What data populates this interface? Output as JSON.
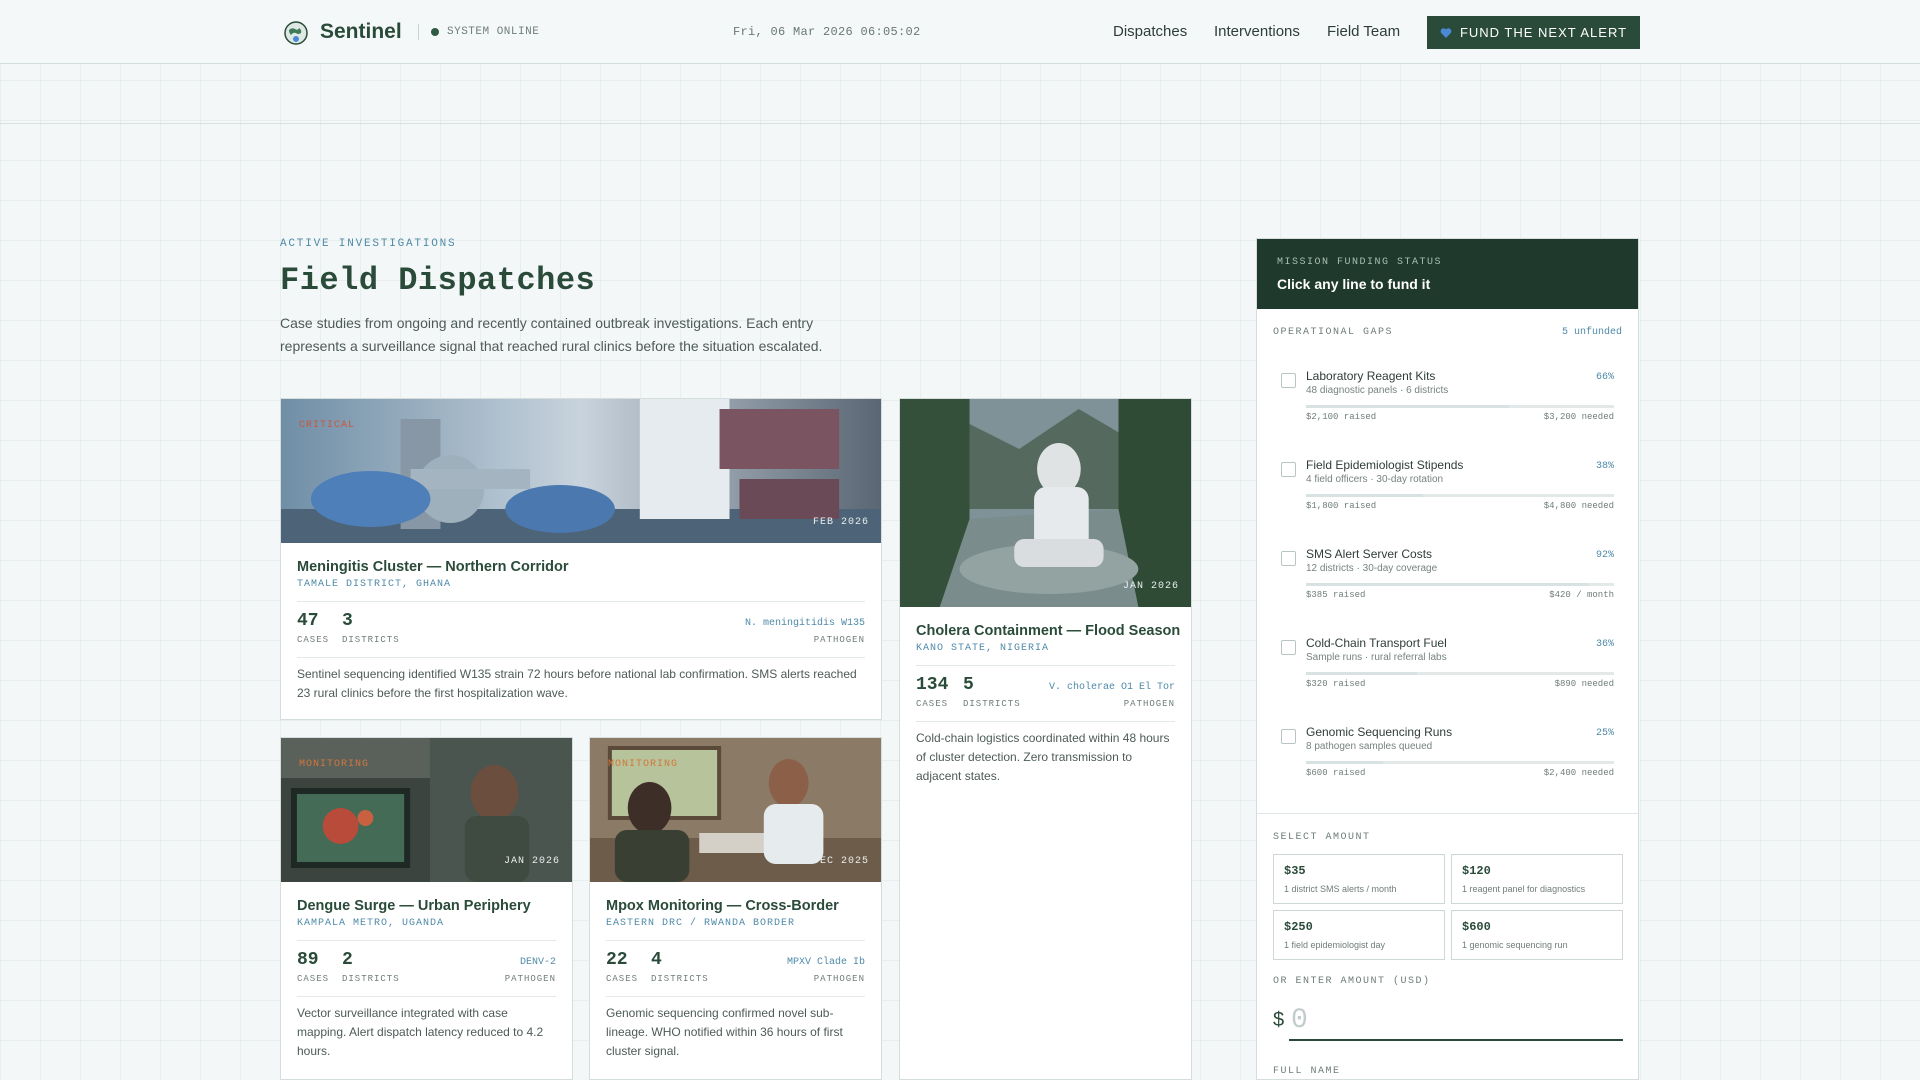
{
  "header": {
    "brand": "Sentinel",
    "status": "SYSTEM ONLINE",
    "clock": "Fri, 06 Mar 2026 06:05:02",
    "nav": [
      "Dispatches",
      "Interventions",
      "Field Team"
    ],
    "cta": "FUND THE NEXT ALERT"
  },
  "intro": {
    "eyebrow": "ACTIVE INVESTIGATIONS",
    "title": "Field Dispatches",
    "description": "Case studies from ongoing and recently contained outbreak investigations. Each entry represents a surveillance signal that reached rural clinics before the situation escalated."
  },
  "dispatches": [
    {
      "tag": "CRITICAL",
      "date": "FEB 2026",
      "title": "Meningitis Cluster — Northern Corridor",
      "location": "TAMALE DISTRICT, GHANA",
      "cases": "47",
      "cases_label": "CASES",
      "districts": "3",
      "districts_label": "DISTRICTS",
      "pathogen": "N. meningitidis W135",
      "pathogen_label": "PATHOGEN",
      "description": "Sentinel sequencing identified W135 strain 72 hours before national lab confirmation. SMS alerts reached 23 rural clinics before the first hospitalization wave."
    },
    {
      "tag": "",
      "date": "JAN 2026",
      "title": "Cholera Containment — Flood Season",
      "location": "KANO STATE, NIGERIA",
      "cases": "134",
      "cases_label": "CASES",
      "districts": "5",
      "districts_label": "DISTRICTS",
      "pathogen": "V. cholerae O1 El Tor",
      "pathogen_label": "PATHOGEN",
      "description": "Cold-chain logistics coordinated within 48 hours of cluster detection. Zero transmission to adjacent states."
    },
    {
      "tag": "MONITORING",
      "date": "JAN 2026",
      "title": "Dengue Surge — Urban Periphery",
      "location": "KAMPALA METRO, UGANDA",
      "cases": "89",
      "cases_label": "CASES",
      "districts": "2",
      "districts_label": "DISTRICTS",
      "pathogen": "DENV-2",
      "pathogen_label": "PATHOGEN",
      "description": "Vector surveillance integrated with case mapping. Alert dispatch latency reduced to 4.2 hours."
    },
    {
      "tag": "MONITORING",
      "date": "DEC 2025",
      "title": "Mpox Monitoring — Cross-Border",
      "location": "EASTERN DRC / RWANDA BORDER",
      "cases": "22",
      "cases_label": "CASES",
      "districts": "4",
      "districts_label": "DISTRICTS",
      "pathogen": "MPXV Clade Ib",
      "pathogen_label": "PATHOGEN",
      "description": "Genomic sequencing confirmed novel sub-lineage. WHO notified within 36 hours of first cluster signal."
    }
  ],
  "funding": {
    "eyebrow": "MISSION FUNDING STATUS",
    "title": "Click any line to fund it",
    "gaps_label": "OPERATIONAL GAPS",
    "unfunded": "5 unfunded",
    "gaps": [
      {
        "title": "Laboratory Reagent Kits",
        "subtitle": "48 diagnostic panels · 6 districts",
        "percent": "66%",
        "progress": 0.66,
        "raised": "$2,100 raised",
        "needed": "$3,200 needed"
      },
      {
        "title": "Field Epidemiologist Stipends",
        "subtitle": "4 field officers · 30-day rotation",
        "percent": "38%",
        "progress": 0.38,
        "raised": "$1,800 raised",
        "needed": "$4,800 needed"
      },
      {
        "title": "SMS Alert Server Costs",
        "subtitle": "12 districts · 30-day coverage",
        "percent": "92%",
        "progress": 0.92,
        "raised": "$385 raised",
        "needed": "$420 / month"
      },
      {
        "title": "Cold-Chain Transport Fuel",
        "subtitle": "Sample runs · rural referral labs",
        "percent": "36%",
        "progress": 0.36,
        "raised": "$320 raised",
        "needed": "$890 needed"
      },
      {
        "title": "Genomic Sequencing Runs",
        "subtitle": "8 pathogen samples queued",
        "percent": "25%",
        "progress": 0.25,
        "raised": "$600 raised",
        "needed": "$2,400 needed"
      }
    ],
    "amount_label": "SELECT AMOUNT",
    "amounts": [
      {
        "value": "$35",
        "desc": "1 district SMS alerts / month"
      },
      {
        "value": "$120",
        "desc": "1 reagent panel for diagnostics"
      },
      {
        "value": "$250",
        "desc": "1 field epidemiologist day"
      },
      {
        "value": "$600",
        "desc": "1 genomic sequencing run"
      }
    ],
    "custom_label": "OR ENTER AMOUNT (USD)",
    "currency": "$",
    "amount_placeholder": "0",
    "name_label": "FULL NAME"
  },
  "colors": {
    "brand": "#2a4b3a",
    "panel_head": "#1f3a2c",
    "accent": "#4e8aa8",
    "critical": "#c9573c",
    "monitoring": "#d2773c",
    "heart": "#4a8ad4"
  }
}
